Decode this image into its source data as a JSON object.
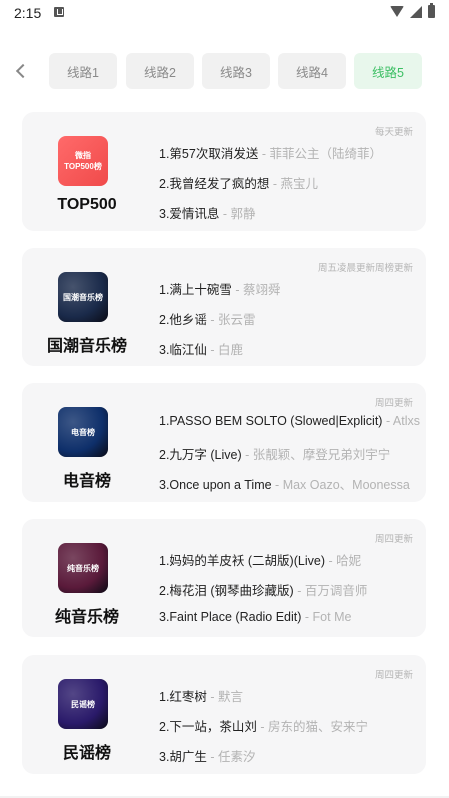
{
  "status": {
    "time": "2:15"
  },
  "tabs": [
    "线路1",
    "线路2",
    "线路3",
    "线路4",
    "线路5"
  ],
  "active_tab": 4,
  "charts": [
    {
      "update": "每天更新",
      "cover_line1": "微指",
      "cover_line2": "TOP500榜",
      "cover_color": "#f04a4a",
      "name": "TOP500",
      "songs": [
        {
          "title": "1.第57次取消发送",
          "artist": "菲菲公主（陆绮菲）"
        },
        {
          "title": "2.我曾经发了疯的想",
          "artist": "燕宝儿"
        },
        {
          "title": "3.爱情讯息",
          "artist": "郭静"
        }
      ]
    },
    {
      "update": "周五凌晨更新周榜更新",
      "cover_line1": "国潮音乐榜",
      "cover_line2": "",
      "cover_color": "#1a2a4a",
      "name": "国潮音乐榜",
      "songs": [
        {
          "title": "1.满上十碗雪",
          "artist": "蔡翊舜"
        },
        {
          "title": "2.他乡谣",
          "artist": "张云雷"
        },
        {
          "title": "3.临江仙",
          "artist": "白鹿"
        }
      ]
    },
    {
      "update": "周四更新",
      "cover_line1": "电音榜",
      "cover_line2": "",
      "cover_color": "#0e2f6a",
      "name": "电音榜",
      "songs": [
        {
          "title": "1.PASSO BEM SOLTO (Slowed|Explicit)",
          "artist": "Atlxs"
        },
        {
          "title": "2.九万字 (Live)",
          "artist": "张靓颖、摩登兄弟刘宇宁"
        },
        {
          "title": "3.Once upon a Time",
          "artist": "Max Oazo、Moonessa"
        }
      ]
    },
    {
      "update": "周四更新",
      "cover_line1": "纯音乐榜",
      "cover_line2": "",
      "cover_color": "#5a1a3a",
      "name": "纯音乐榜",
      "songs": [
        {
          "title": "1.妈妈的羊皮袄 (二胡版)(Live)",
          "artist": "哈妮"
        },
        {
          "title": "2.梅花泪 (钢琴曲珍藏版)",
          "artist": "百万调音师"
        },
        {
          "title": "3.Faint Place (Radio Edit)",
          "artist": "Fot Me"
        }
      ]
    },
    {
      "update": "周四更新",
      "cover_line1": "民谣榜",
      "cover_line2": "",
      "cover_color": "#2a1a6a",
      "name": "民谣榜",
      "songs": [
        {
          "title": "1.红枣树",
          "artist": "默言"
        },
        {
          "title": "2.下一站，茶山刘",
          "artist": "房东的猫、安来宁"
        },
        {
          "title": "3.胡广生",
          "artist": "任素汐"
        }
      ]
    }
  ]
}
